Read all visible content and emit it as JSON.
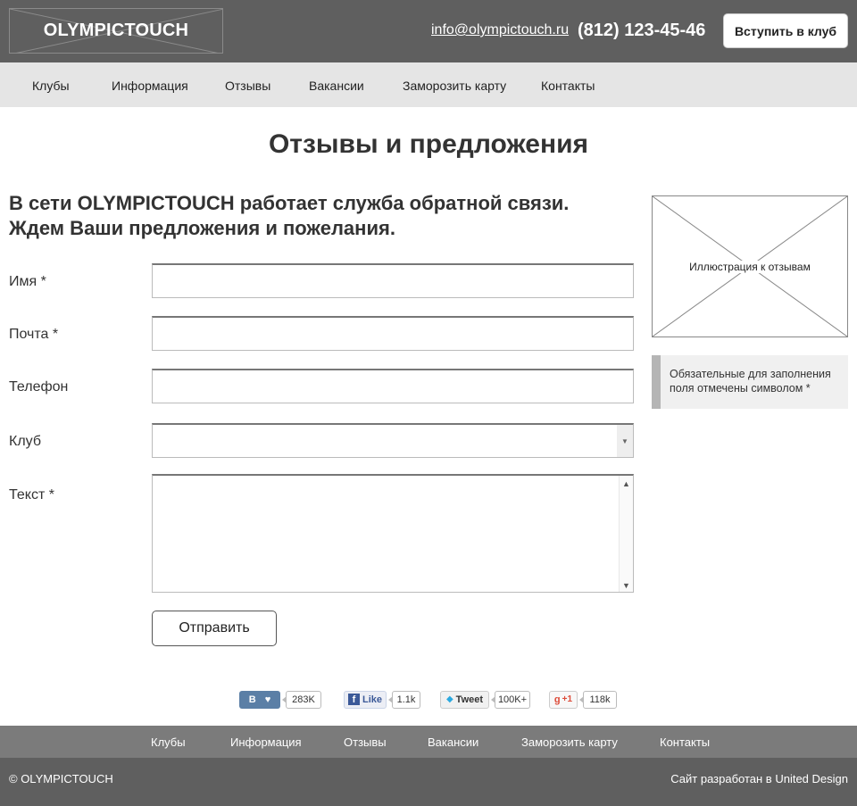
{
  "header": {
    "logo": "OLYMPICTOUCH",
    "email": "info@olympictouch.ru",
    "phone": "(812) 123-45-46",
    "join_label": "Вступить в клуб"
  },
  "nav": {
    "items": [
      "Клубы",
      "Информация",
      "Отзывы",
      "Вакансии",
      "Заморозить карту",
      "Контакты"
    ]
  },
  "page": {
    "title": "Отзывы и предложения",
    "intro_line1": "В сети OLYMPICTOUCH работает служба обратной связи.",
    "intro_line2": "Ждем Ваши предложения и пожелания."
  },
  "form": {
    "name_label": "Имя *",
    "email_label": "Почта *",
    "phone_label": "Телефон",
    "club_label": "Клуб",
    "text_label": "Текст *",
    "name_value": "",
    "email_value": "",
    "phone_value": "",
    "club_value": "",
    "text_value": "",
    "submit_label": "Отправить"
  },
  "sidebar": {
    "illustration_label": "Иллюстрация к отзывам",
    "note": "Обязательные для заполнения поля отмечены символом *"
  },
  "social": {
    "vk_label": "В",
    "vk_count": "283K",
    "fb_label": "Like",
    "fb_count": "1.1k",
    "tw_label": "Tweet",
    "tw_count": "100K+",
    "gp_label": "+1",
    "gp_count": "118k"
  },
  "footer_nav": {
    "items": [
      "Клубы",
      "Информация",
      "Отзывы",
      "Вакансии",
      "Заморозить карту",
      "Контакты"
    ]
  },
  "footer": {
    "copyright": "© OLYMPICTOUCH",
    "credits": "Сайт разработан в United Design"
  },
  "colors": {
    "header_bg": "#5f5f5f",
    "nav_bg": "#e5e5e5",
    "footer_nav_bg": "#7b7b7b",
    "vk": "#5b7fa6",
    "fb": "#3b5998",
    "gp": "#dd4b39"
  }
}
